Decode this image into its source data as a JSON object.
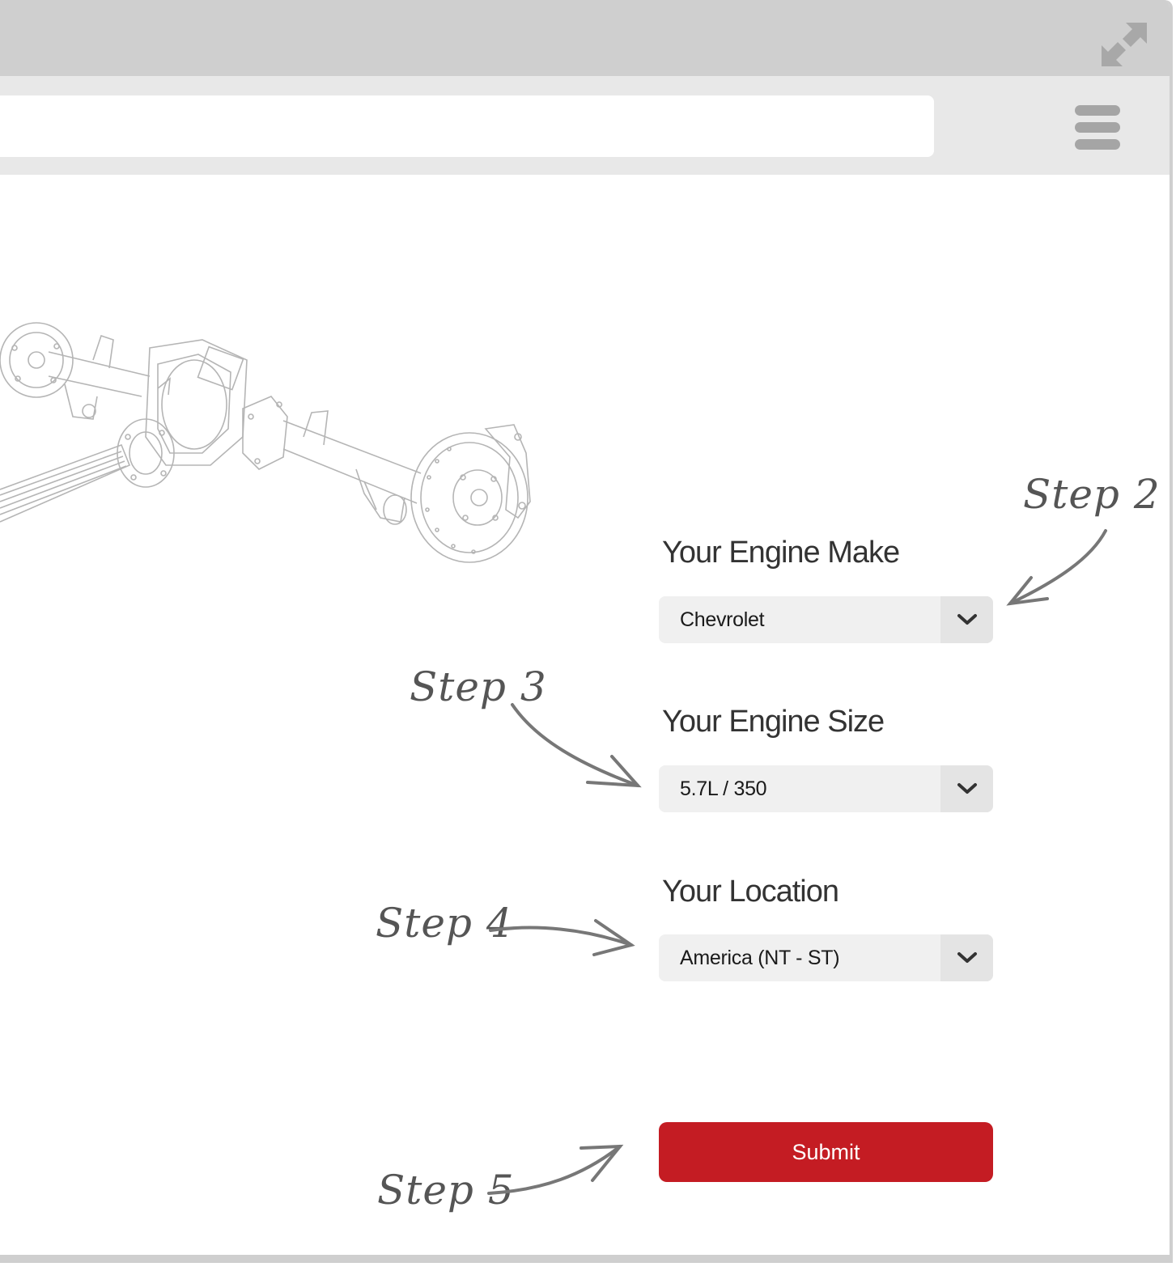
{
  "browser": {
    "url_value": "",
    "expand_icon": "expand-arrows-icon",
    "menu_icon": "hamburger-menu-icon"
  },
  "illustration": {
    "subject": "rear-axle-line-drawing"
  },
  "form": {
    "engine_make": {
      "label": "Your Engine Make",
      "value": "Chevrolet"
    },
    "engine_size": {
      "label": "Your Engine Size",
      "value": "5.7L / 350"
    },
    "location": {
      "label": "Your Location",
      "value": "America (NT - ST)"
    },
    "submit_label": "Submit"
  },
  "annotations": {
    "step2": "Step 2",
    "step3": "Step 3",
    "step4": "Step 4",
    "step5": "Step 5"
  },
  "colors": {
    "accent": "#c41c23",
    "chrome": "#cfcfcf",
    "toolbar": "#e8e8e8",
    "arrow": "#777777"
  }
}
